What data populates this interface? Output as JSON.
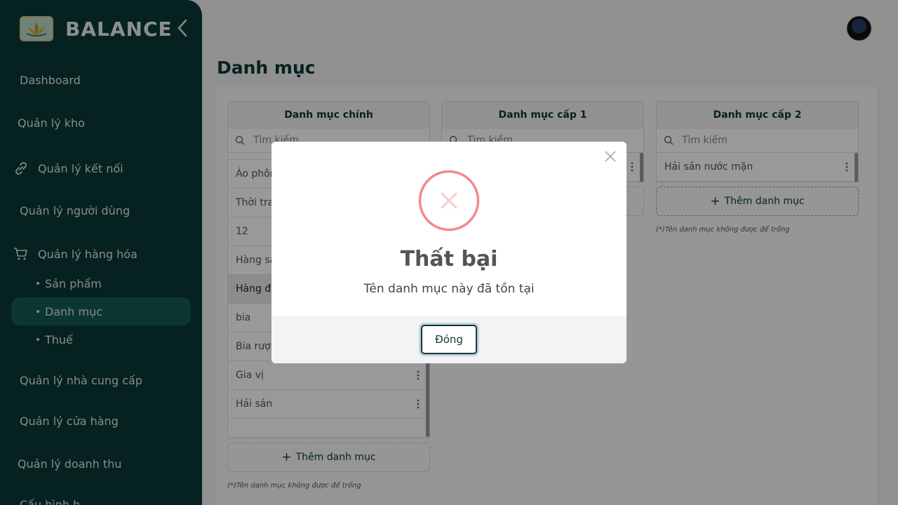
{
  "sidebar": {
    "brand": "BALANCE",
    "nav": {
      "dashboard": "Dashboard",
      "warehouse": "Quản lý kho",
      "connections": "Quản lý kết nối",
      "users": "Quản lý người dùng",
      "goods": "Quản lý hàng hóa",
      "sub_products": "Sản phẩm",
      "sub_categories": "Danh mục",
      "sub_tax": "Thuế",
      "suppliers": "Quản lý nhà cung cấp",
      "stores": "Quản lý cửa hàng",
      "revenue": "Quản lý doanh thu",
      "partial": "Cấu hình h"
    }
  },
  "page": {
    "title": "Danh mục"
  },
  "columns": {
    "main": {
      "header": "Danh mục chính",
      "search_placeholder": "Tìm kiếm",
      "items": [
        "Áo phông",
        "Thời trang",
        "12",
        "Hàng sạch",
        "Hàng đông lạnh",
        "bia",
        "Bia rượu",
        "Gia vị",
        "Hải sản"
      ],
      "add_label": "Thêm danh mục",
      "note": "(*)Tên danh mục không được để trống"
    },
    "level1": {
      "header": "Danh mục cấp 1",
      "search_placeholder": "Tìm kiếm"
    },
    "level2": {
      "header": "Danh mục cấp 2",
      "search_placeholder": "Tìm kiếm",
      "items": [
        "Hải sản nước mặn"
      ],
      "add_label": "Thêm danh mục",
      "note": "(*)Tên danh mục không được để trống"
    }
  },
  "modal": {
    "title": "Thất bại",
    "message": "Tên danh mục này đã tồn tại",
    "button": "Đóng"
  },
  "colors": {
    "sidebar": "#0b3a36",
    "active": "#145a52",
    "error": "#f27474"
  }
}
